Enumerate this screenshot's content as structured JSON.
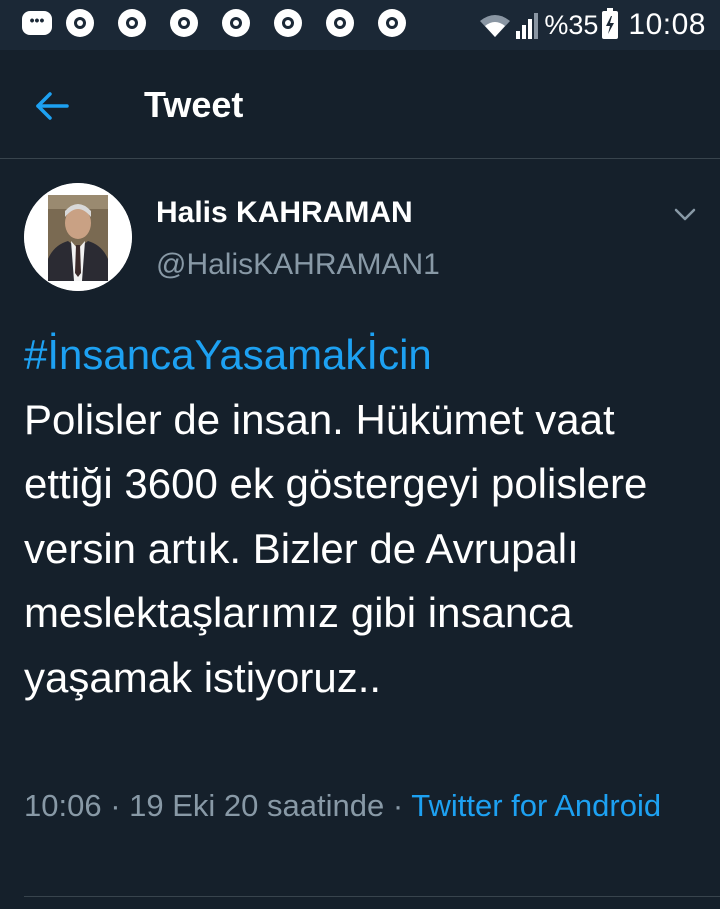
{
  "status_bar": {
    "battery_percent": "%35",
    "time": "10:08",
    "notification_icons": [
      "message-icon",
      "chrome-icon",
      "chrome-icon",
      "chrome-icon",
      "chrome-icon",
      "chrome-icon",
      "chrome-icon",
      "chrome-icon"
    ]
  },
  "header": {
    "title": "Tweet",
    "back_icon": "arrow-left-icon"
  },
  "tweet": {
    "display_name": "Halis KAHRAMAN",
    "handle": "@HalisKAHRAMAN1",
    "hashtag": "#İnsancaYasamakİcin",
    "text": "Polisler de insan. Hükümet vaat ettiği 3600 ek göstergeyi polislere versin artık. Bizler de Avrupalı meslektaşlarımız gibi insanca yaşamak istiyoruz..",
    "time": "10:06",
    "date": "19 Eki 20 saatinde",
    "separator": "·",
    "source": "Twitter for Android"
  },
  "colors": {
    "background": "#15202b",
    "status_bar": "#1b2836",
    "accent": "#1da1f2",
    "secondary_text": "#8899a6",
    "divider": "#38444d"
  }
}
